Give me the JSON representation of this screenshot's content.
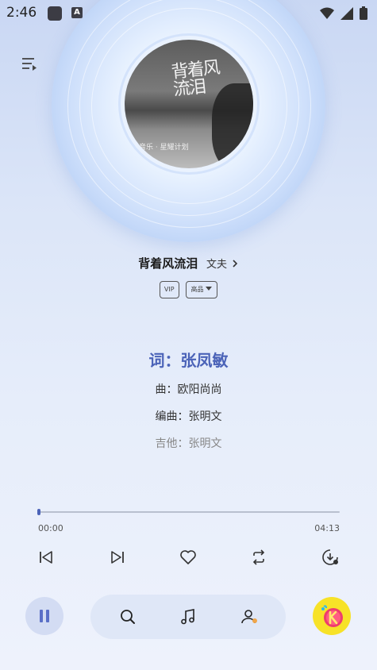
{
  "status_bar": {
    "time": "2:46",
    "a_badge": "A"
  },
  "album": {
    "cover_text": "背着风\n流泪",
    "cover_sub": "音乐 · 星耀计划"
  },
  "song": {
    "title": "背着风流泪",
    "artist": "文夫",
    "badge_vip": "VIP",
    "badge_quality": "高品"
  },
  "lyrics": {
    "active": "词：张凤敏",
    "line1": "曲：欧阳尚尚",
    "line2": "编曲：张明文",
    "line3": "吉他：张明文"
  },
  "progress": {
    "current": "00:00",
    "total": "04:13",
    "fraction": 0.0
  },
  "colors": {
    "accent": "#4b63b8",
    "fab": "#f7e228"
  },
  "icons": [
    "queue-icon",
    "prev-icon",
    "next-icon",
    "heart-icon",
    "repeat-icon",
    "download-icon",
    "pause-icon",
    "search-icon",
    "music-note-icon",
    "profile-icon",
    "k-song-icon"
  ]
}
